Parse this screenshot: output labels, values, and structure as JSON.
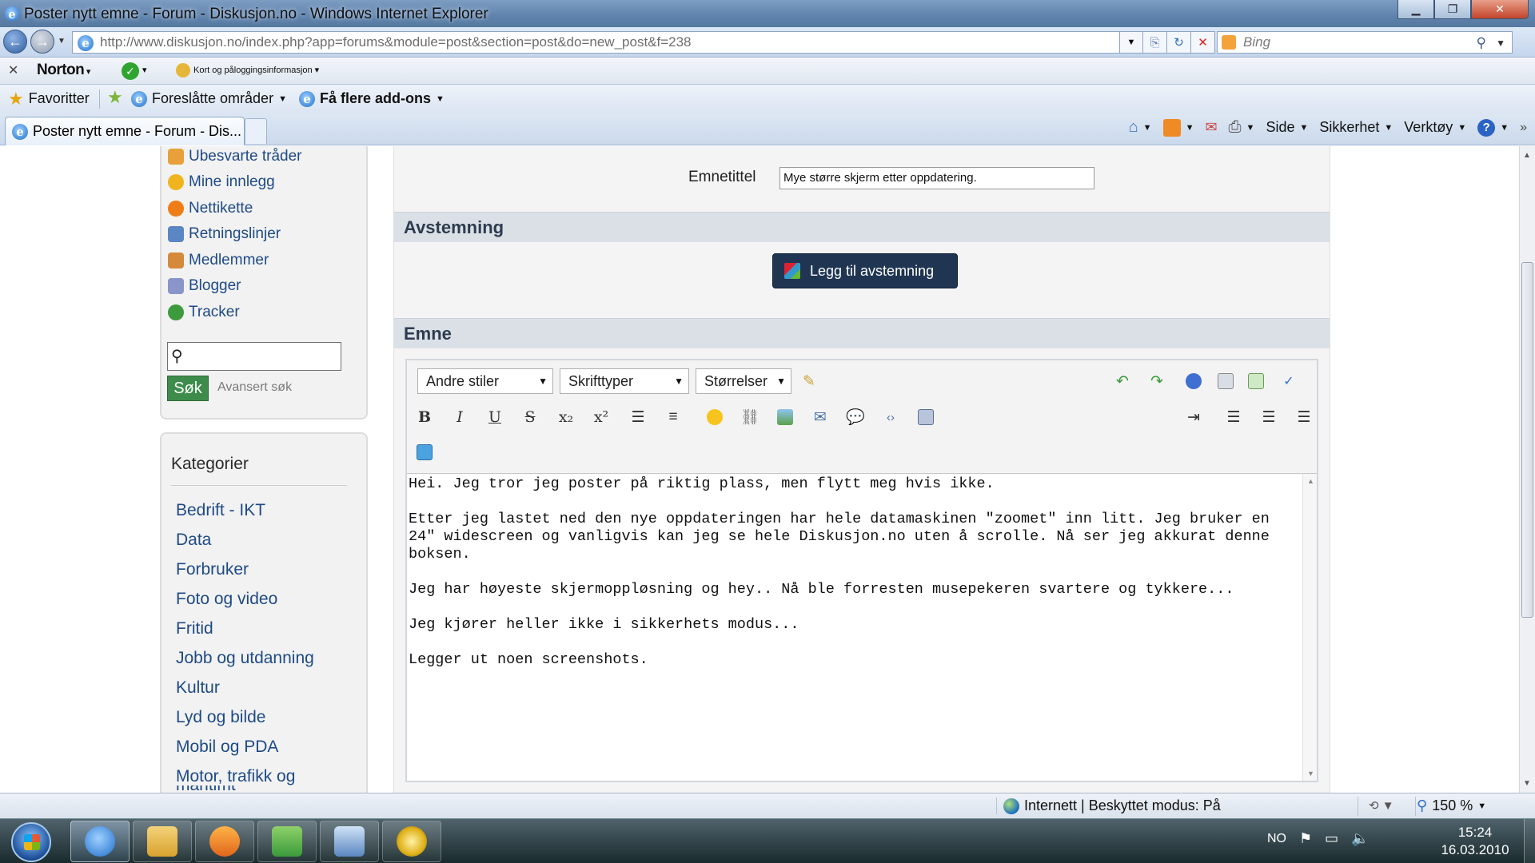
{
  "window": {
    "title": "Poster nytt emne - Forum - Diskusjon.no - Windows Internet Explorer"
  },
  "address": {
    "url": "http://www.diskusjon.no/index.php?app=forums&module=post&section=post&do=new_post&f=238",
    "search_placeholder": "Bing"
  },
  "norton": {
    "brand": "Norton",
    "card_label": "Kort og påloggingsinformasjon"
  },
  "favorites": {
    "favorites_label": "Favoritter",
    "suggested_label": "Foreslåtte områder",
    "addons_label": "Få flere add-ons"
  },
  "tab": {
    "label": "Poster nytt emne - Forum - Dis..."
  },
  "commandbar": {
    "page_label": "Side",
    "safety_label": "Sikkerhet",
    "tools_label": "Verktøy"
  },
  "sidebar": {
    "links": [
      {
        "label": "Ubesvarte tråder",
        "icon": "mail-icon",
        "color": "#e8a13a"
      },
      {
        "label": "Mine innlegg",
        "icon": "smiley-icon",
        "color": "#f0b41e"
      },
      {
        "label": "Nettikette",
        "icon": "warning-icon",
        "color": "#ef7d16"
      },
      {
        "label": "Retningslinjer",
        "icon": "guidelines-icon",
        "color": "#5b86c4"
      },
      {
        "label": "Medlemmer",
        "icon": "members-icon",
        "color": "#d48a3a"
      },
      {
        "label": "Blogger",
        "icon": "blog-icon",
        "color": "#8a95c9"
      },
      {
        "label": "Tracker",
        "icon": "tracker-icon",
        "color": "#3d9a3d"
      }
    ],
    "search_value": "",
    "search_button": "Søk",
    "advanced_search": "Avansert søk",
    "categories_title": "Kategorier",
    "categories": [
      "Bedrift - IKT",
      "Data",
      "Forbruker",
      "Foto og video",
      "Fritid",
      "Jobb og utdanning",
      "Kultur",
      "Lyd og bilde",
      "Mobil og PDA",
      "Motor, trafikk og",
      "maritimt"
    ]
  },
  "main": {
    "subject_label": "Emnetittel",
    "subject_value": "Mye større skjerm etter oppdatering.",
    "poll_header": "Avstemning",
    "poll_button": "Legg til avstemning",
    "topic_header": "Emne",
    "editor": {
      "styles_combo": "Andre stiler",
      "fonts_combo": "Skrifttyper",
      "sizes_combo": "Størrelser",
      "body": "Hei. Jeg tror jeg poster på riktig plass, men flytt meg hvis ikke.\n\nEtter jeg lastet ned den nye oppdateringen har hele datamaskinen \"zoomet\" inn litt. Jeg bruker en 24\" widescreen og vanligvis kan jeg se hele Diskusjon.no uten å scrolle. Nå ser jeg akkurat denne boksen.\n\nJeg har høyeste skjermoppløsning og hey.. Nå ble forresten musepekeren svartere og tykkere...\n\nJeg kjører heller ikke i sikkerhets modus...\n\nLegger ut noen screenshots."
    }
  },
  "status": {
    "zone": "Internett | Beskyttet modus: På",
    "zoom": "150 %"
  },
  "taskbar": {
    "language": "NO",
    "time": "15:24",
    "date": "16.03.2010"
  },
  "colors": {
    "accent": "#1f3552",
    "link": "#1e4a86",
    "section_header_bg": "#dbe0e7",
    "search_button": "#3e8c4c"
  }
}
